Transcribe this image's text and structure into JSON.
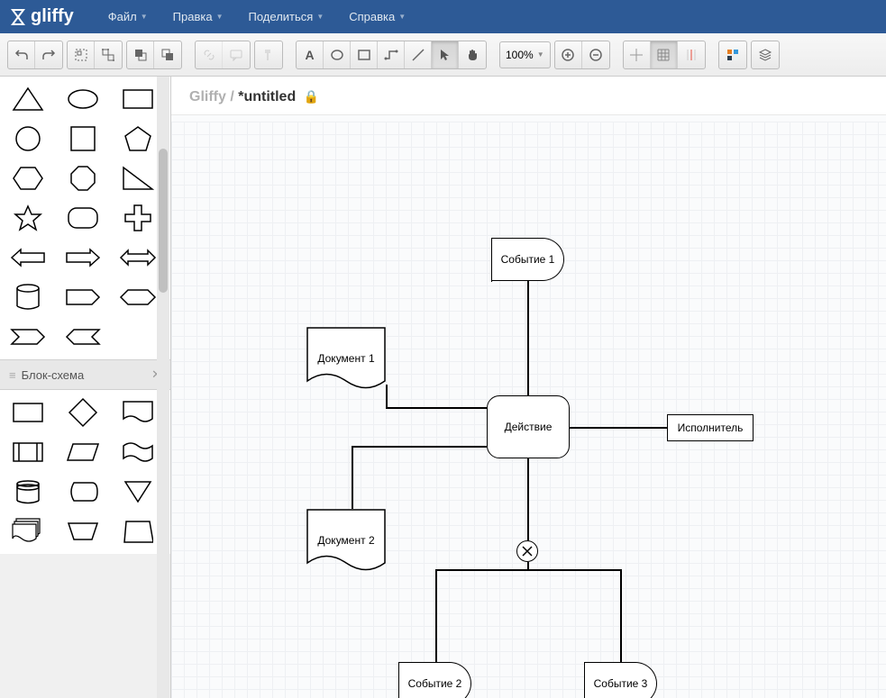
{
  "app": {
    "name": "gliffy"
  },
  "menu": {
    "file": "Файл",
    "edit": "Правка",
    "share": "Поделиться",
    "help": "Справка"
  },
  "toolbar": {
    "zoom": "100%"
  },
  "breadcrumb": {
    "prefix": "Gliffy / ",
    "title": "*untitled"
  },
  "sections": {
    "flowchart": "Блок-схема"
  },
  "diagram": {
    "event1": "Событие 1",
    "event2": "Событие 2",
    "event3": "Событие 3",
    "action": "Действие",
    "performer": "Исполнитель",
    "doc1": "Документ 1",
    "doc2": "Документ 2"
  }
}
